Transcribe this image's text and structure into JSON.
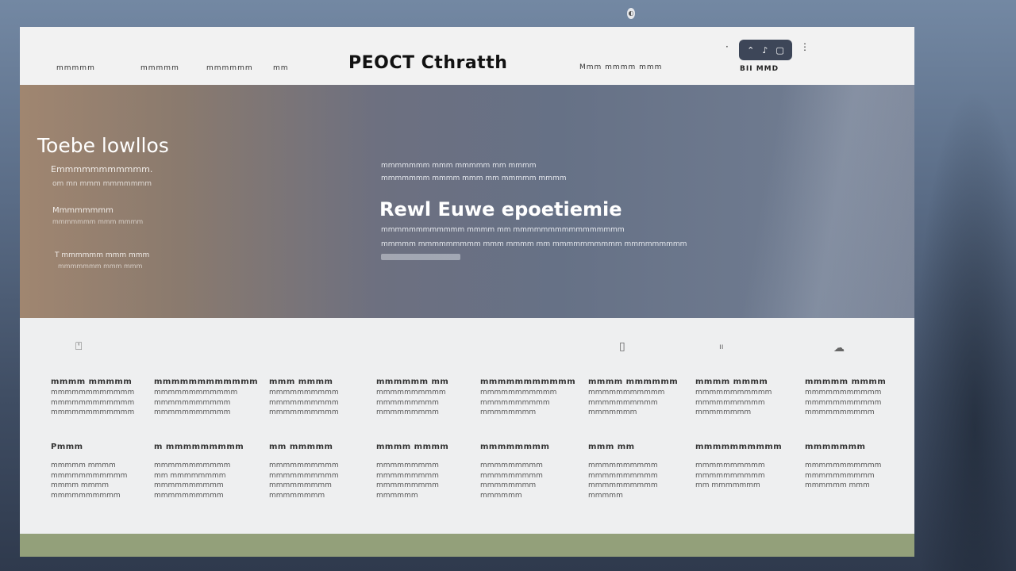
{
  "top_indicator": "◐",
  "header": {
    "nav_links": [
      "mmmmm",
      "mmmmm",
      "mmmmmm",
      "mm"
    ],
    "brand": "PEOCT Cthratth",
    "right_link": "Mmm mmmm mmm",
    "toggle_left": "·",
    "toggle_right": "⋮",
    "pill": {
      "items": [
        "⌃",
        "♪",
        "▢"
      ]
    },
    "pill_caption": "BII MMD"
  },
  "hero": {
    "left": {
      "title": "Toebe lowllos",
      "line1": "Emmmmmmmmmmm.",
      "line2": "om mn mmm mmmmmmm",
      "line3": "Mmmmmmmm",
      "line4": "mmmmmmm mmm mmmm",
      "line5": "T mmmmmm mmm mmm",
      "line6": "mmmmmmm mmm mmm"
    },
    "center": {
      "eyebrow1": "mmmmmmm mmm mmmmm mm mmmm",
      "eyebrow2": "mmmmmmm mmmm mmm mm mmmmm mmmm",
      "heading": "Rewl Euwe epoetiemie",
      "body1": "mmmmmmmmmmmm mmmm mm mmmmmmmmmmmmmmmm",
      "body2": "mmmmm mmmmmmmmm mmm mmmm mm mmmmmmmmmm mmmmmmmmm"
    }
  },
  "features": {
    "icons": [
      "bottle-icon",
      "cup-icon",
      "dots-icon",
      "cloud-icon"
    ],
    "columns": [
      {
        "t1": "mmmm mmmmm",
        "a": [
          "mmmmmmmmmmmm",
          "mmmmmmmmmmmm",
          "mmmmmmmmmmmm"
        ],
        "t2": "Pmmm",
        "b": [
          "mmmmm mmmm",
          "mmmmmmmmmmm",
          "mmmm mmmm",
          "mmmmmmmmmm"
        ]
      },
      {
        "t1": "mmmmmmmmmmmm",
        "a": [
          "mmmmmmmmmmmm",
          "mmmmmmmmmmm",
          "mmmmmmmmmmm"
        ],
        "t2": "m mmmmmmmmm",
        "b": [
          "mmmmmmmmmmm",
          "mm mmmmmmmm",
          "mmmmmmmmmm",
          "mmmmmmmmmm"
        ]
      },
      {
        "t1": "mmm mmmm",
        "a": [
          "mmmmmmmmmm",
          "mmmmmmmmmm",
          "mmmmmmmmmm"
        ],
        "t2": "mm mmmmm",
        "b": [
          "mmmmmmmmmm",
          "mmmmmmmmmm",
          "mmmmmmmmm",
          "mmmmmmmm"
        ]
      },
      {
        "t1": "mmmmmm mm",
        "a": [
          "mmmmmmmmmm",
          "mmmmmmmmm",
          "mmmmmmmmm"
        ],
        "t2": "mmmm mmmm",
        "b": [
          "mmmmmmmmm",
          "mmmmmmmmm",
          "mmmmmmmmm",
          "mmmmmm"
        ]
      },
      {
        "t1": "mmmmmmmmmmm",
        "a": [
          "mmmmmmmmmmm",
          "mmmmmmmmmm",
          "mmmmmmmm"
        ],
        "t2": "mmmmmmmm",
        "b": [
          "mmmmmmmmm",
          "mmmmmmmmm",
          "mmmmmmmm",
          "mmmmmm"
        ]
      },
      {
        "t1": "mmmm mmmmmm",
        "a": [
          "mmmmmmmmmmm",
          "mmmmmmmmmm",
          "mmmmmmm"
        ],
        "t2": "mmm  mm",
        "b": [
          "mmmmmmmmmm",
          "mmmmmmmmmm",
          "mmmmmmmmmm",
          "mmmmm"
        ]
      },
      {
        "t1": "mmmm mmmm",
        "a": [
          "mmmmmmmmmmm",
          "mmmmmmmmmm",
          "mmmmmmmm"
        ],
        "t2": "mmmmmmmmmm",
        "b": [
          "mmmmmmmmmm",
          "mmmmmmmmmm",
          "mm mmmmmmm"
        ]
      },
      {
        "t1": "mmmmm mmmm",
        "a": [
          "mmmmmmmmmmm",
          "mmmmmmmmmmm",
          "mmmmmmmmmm"
        ],
        "t2": "mmmmmmm",
        "b": [
          "mmmmmmmmmmm",
          "mmmmmmmmmm",
          "mmmmmm mmm"
        ]
      }
    ]
  }
}
